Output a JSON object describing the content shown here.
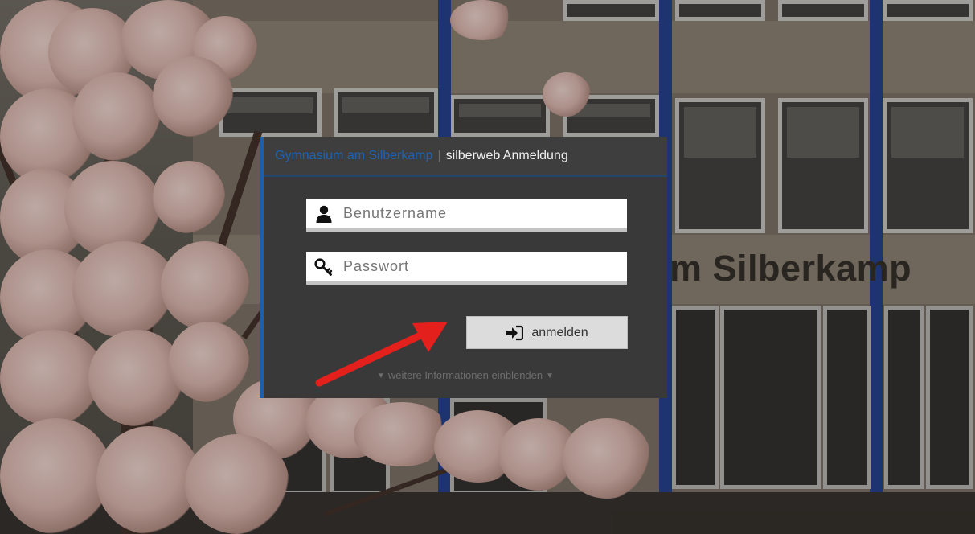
{
  "header": {
    "school_name": "Gymnasium am Silberkamp",
    "separator": "|",
    "app_title": "silberweb Anmeldung"
  },
  "form": {
    "username_placeholder": "Benutzername",
    "username_value": "",
    "password_placeholder": "Passwort",
    "password_value": "",
    "submit_label": "anmelden",
    "more_info_label": "weitere Informationen einblenden"
  },
  "background": {
    "facade_text": "m Silberkamp"
  },
  "icons": {
    "username": "user-icon",
    "password": "key-icon",
    "submit": "sign-in-icon",
    "more_info": "chevron-down-icon"
  },
  "colors": {
    "accent": "#1d5fa8",
    "panel_bg": "#393939",
    "annotation_arrow": "#e3201b"
  }
}
